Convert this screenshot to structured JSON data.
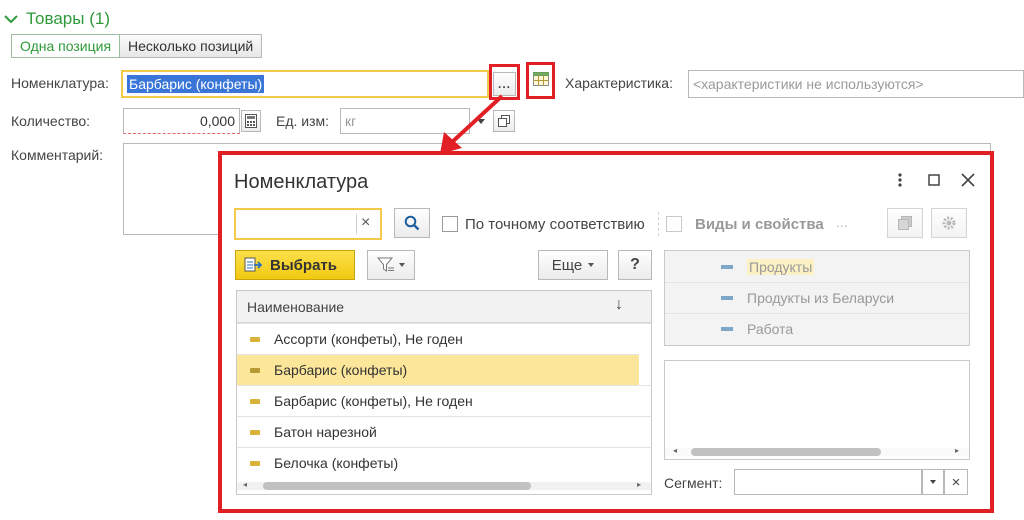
{
  "section": {
    "title": "Товары (1)"
  },
  "tabs": [
    {
      "label": "Одна позиция",
      "active": true
    },
    {
      "label": "Несколько позиций",
      "active": false
    }
  ],
  "form": {
    "nomenclature_label": "Номенклатура:",
    "nomenclature_value": "Барбарис (конфеты)",
    "select_button": "...",
    "characteristic_label": "Характеристика:",
    "characteristic_value": "<характеристики не используются>",
    "quantity_label": "Количество:",
    "quantity_value": "0,000",
    "unit_label": "Ед. изм:",
    "unit_value": "кг",
    "comment_label": "Комментарий:"
  },
  "dialog": {
    "title": "Номенклатура",
    "search_placeholder": "",
    "search_clear": "×",
    "exact_match_label": "По точному соответствию",
    "kinds_label": "Виды и свойства",
    "kinds_more": "...",
    "select_button": "Выбрать",
    "more_button": "Еще",
    "help_button": "?",
    "column_header": "Наименование",
    "sort_indicator": "↓",
    "items": [
      {
        "name": "Ассорти (конфеты), Не годен",
        "selected": false
      },
      {
        "name": "Барбарис (конфеты)",
        "selected": true
      },
      {
        "name": "Барбарис (конфеты), Не годен",
        "selected": false
      },
      {
        "name": "Батон нарезной",
        "selected": false
      },
      {
        "name": "Белочка (конфеты)",
        "selected": false
      }
    ],
    "kinds": [
      {
        "name": "Продукты",
        "selected": true
      },
      {
        "name": "Продукты из Беларуси",
        "selected": false
      },
      {
        "name": "Работа",
        "selected": false
      }
    ],
    "segment_label": "Сегмент:",
    "segment_value": "",
    "segment_clear": "×"
  },
  "colors": {
    "accent_green": "#2f9a3a",
    "highlight_red": "#e21f25",
    "selected_row": "#fbe69a",
    "select_button": "#f7d51d"
  }
}
